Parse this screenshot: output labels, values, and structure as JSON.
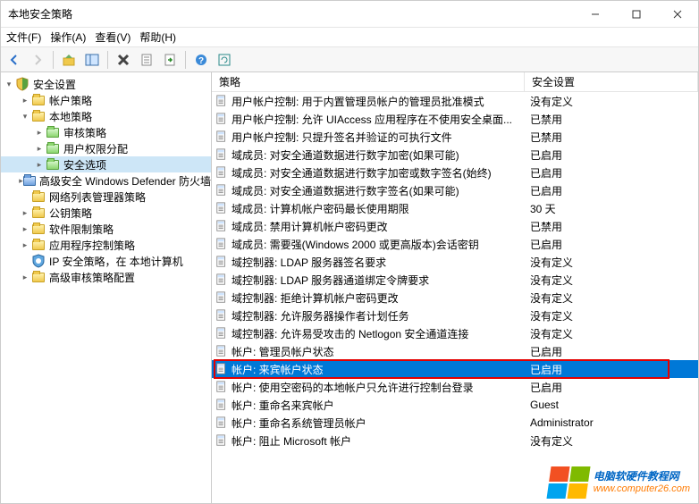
{
  "window": {
    "title": "本地安全策略"
  },
  "menu": {
    "file": "文件(F)",
    "action": "操作(A)",
    "view": "查看(V)",
    "help": "帮助(H)"
  },
  "tree": {
    "root": "安全设置",
    "items": [
      {
        "label": "帐户策略",
        "depth": 1,
        "expanded": false,
        "twisty": true,
        "icon": "folder"
      },
      {
        "label": "本地策略",
        "depth": 1,
        "expanded": true,
        "twisty": true,
        "icon": "folder"
      },
      {
        "label": "审核策略",
        "depth": 2,
        "icon": "folder-green",
        "twisty": true,
        "expanded": false
      },
      {
        "label": "用户权限分配",
        "depth": 2,
        "icon": "folder-green",
        "twisty": true,
        "expanded": false
      },
      {
        "label": "安全选项",
        "depth": 2,
        "icon": "folder-green",
        "twisty": true,
        "expanded": false,
        "selected": true
      },
      {
        "label": "高级安全 Windows Defender 防火墙",
        "depth": 1,
        "icon": "folder-blue",
        "twisty": true,
        "expanded": false
      },
      {
        "label": "网络列表管理器策略",
        "depth": 1,
        "icon": "folder"
      },
      {
        "label": "公钥策略",
        "depth": 1,
        "icon": "folder",
        "twisty": true,
        "expanded": false
      },
      {
        "label": "软件限制策略",
        "depth": 1,
        "icon": "folder",
        "twisty": true,
        "expanded": false
      },
      {
        "label": "应用程序控制策略",
        "depth": 1,
        "icon": "folder",
        "twisty": true,
        "expanded": false
      },
      {
        "label": "IP 安全策略，在 本地计算机",
        "depth": 1,
        "icon": "shield"
      },
      {
        "label": "高级审核策略配置",
        "depth": 1,
        "icon": "folder",
        "twisty": true,
        "expanded": false
      }
    ]
  },
  "list": {
    "headers": {
      "policy": "策略",
      "setting": "安全设置"
    },
    "rows": [
      {
        "p": "用户帐户控制: 用于内置管理员帐户的管理员批准模式",
        "s": "没有定义"
      },
      {
        "p": "用户帐户控制: 允许 UIAccess 应用程序在不使用安全桌面...",
        "s": "已禁用"
      },
      {
        "p": "用户帐户控制: 只提升签名并验证的可执行文件",
        "s": "已禁用"
      },
      {
        "p": "域成员: 对安全通道数据进行数字加密(如果可能)",
        "s": "已启用"
      },
      {
        "p": "域成员: 对安全通道数据进行数字加密或数字签名(始终)",
        "s": "已启用"
      },
      {
        "p": "域成员: 对安全通道数据进行数字签名(如果可能)",
        "s": "已启用"
      },
      {
        "p": "域成员: 计算机帐户密码最长使用期限",
        "s": "30 天"
      },
      {
        "p": "域成员: 禁用计算机帐户密码更改",
        "s": "已禁用"
      },
      {
        "p": "域成员: 需要强(Windows 2000 或更高版本)会话密钥",
        "s": "已启用"
      },
      {
        "p": "域控制器: LDAP 服务器签名要求",
        "s": "没有定义"
      },
      {
        "p": "域控制器: LDAP 服务器通道绑定令牌要求",
        "s": "没有定义"
      },
      {
        "p": "域控制器: 拒绝计算机帐户密码更改",
        "s": "没有定义"
      },
      {
        "p": "域控制器: 允许服务器操作者计划任务",
        "s": "没有定义"
      },
      {
        "p": "域控制器: 允许易受攻击的 Netlogon 安全通道连接",
        "s": "没有定义"
      },
      {
        "p": "帐户: 管理员帐户状态",
        "s": "已启用"
      },
      {
        "p": "帐户: 来宾帐户状态",
        "s": "已启用",
        "selected": true
      },
      {
        "p": "帐户: 使用空密码的本地帐户只允许进行控制台登录",
        "s": "已启用"
      },
      {
        "p": "帐户: 重命名来宾帐户",
        "s": "Guest"
      },
      {
        "p": "帐户: 重命名系统管理员帐户",
        "s": "Administrator"
      },
      {
        "p": "帐户: 阻止 Microsoft 帐户",
        "s": "没有定义"
      }
    ]
  },
  "watermark": {
    "line1": "电脑软硬件教程网",
    "line2": "www.computer26.com"
  }
}
